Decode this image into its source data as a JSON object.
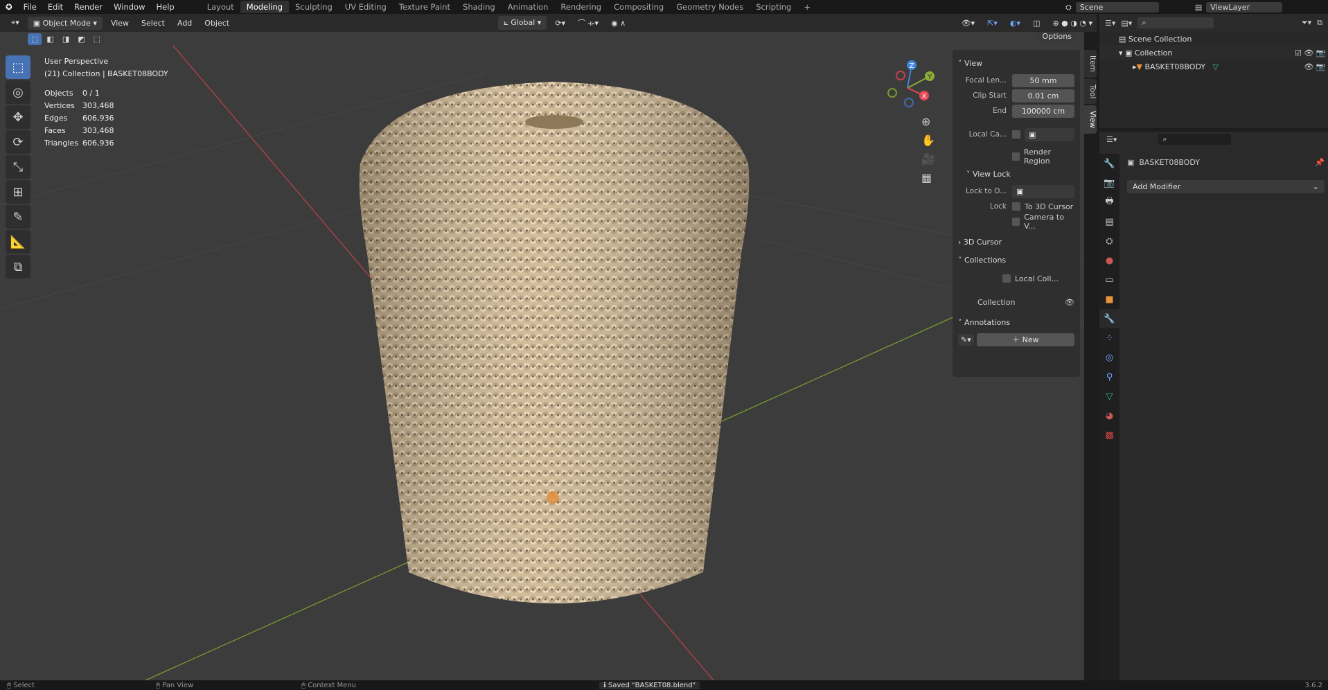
{
  "menu": {
    "items": [
      "File",
      "Edit",
      "Render",
      "Window",
      "Help"
    ],
    "workspaces": [
      "Layout",
      "Modeling",
      "Sculpting",
      "UV Editing",
      "Texture Paint",
      "Shading",
      "Animation",
      "Rendering",
      "Compositing",
      "Geometry Nodes",
      "Scripting"
    ],
    "active_workspace": "Modeling",
    "add_workspace": "+",
    "scene": "Scene",
    "view_layer": "ViewLayer"
  },
  "header": {
    "mode": "Object Mode",
    "menus": [
      "View",
      "Select",
      "Add",
      "Object"
    ],
    "transform_orientation": "Global",
    "options": "Options"
  },
  "viewport": {
    "perspective": "User Perspective",
    "collection_line": "(21) Collection | BASKET08BODY",
    "stats": [
      {
        "label": "Objects",
        "value": "0 / 1"
      },
      {
        "label": "Vertices",
        "value": "303,468"
      },
      {
        "label": "Edges",
        "value": "606,936"
      },
      {
        "label": "Faces",
        "value": "303,468"
      },
      {
        "label": "Triangles",
        "value": "606,936"
      }
    ],
    "gizmo": {
      "x": "X",
      "y": "Y",
      "z": "Z"
    },
    "colors": {
      "x_axis": "#b5434b",
      "y_axis": "#7a9a2e",
      "basket": "#d9c4a3"
    }
  },
  "npanel": {
    "tabs": [
      "Item",
      "Tool",
      "View"
    ],
    "active_tab": "View",
    "view": {
      "title": "View",
      "focal_label": "Focal Len...",
      "focal": "50 mm",
      "clip_start_label": "Clip Start",
      "clip_start": "0.01 cm",
      "end_label": "End",
      "end": "100000 cm",
      "local_camera_label": "Local Ca...",
      "render_region": "Render Region"
    },
    "view_lock": {
      "title": "View Lock",
      "lock_to_label": "Lock to O...",
      "lock_label": "Lock",
      "to_cursor": "To 3D Cursor",
      "camera_to_view": "Camera to V..."
    },
    "cursor": {
      "title": "3D Cursor"
    },
    "collections": {
      "title": "Collections",
      "local": "Local Coll...",
      "collection": "Collection"
    },
    "annotations": {
      "title": "Annotations",
      "new": "New"
    }
  },
  "outliner": {
    "scene_collection": "Scene Collection",
    "collection": "Collection",
    "object": "BASKET08BODY"
  },
  "properties": {
    "object": "BASKET08BODY",
    "add_modifier": "Add Modifier"
  },
  "status": {
    "select": "Select",
    "pan": "Pan View",
    "context": "Context Menu",
    "saved": "Saved \"BASKET08.blend\"",
    "version": "3.6.2"
  }
}
